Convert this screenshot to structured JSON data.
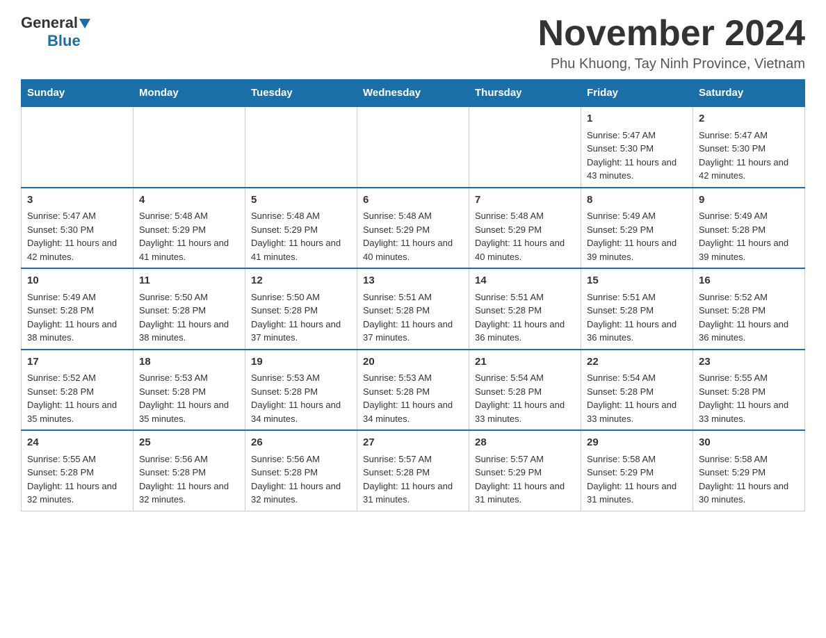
{
  "logo": {
    "general": "General",
    "triangle": "",
    "blue": "Blue"
  },
  "header": {
    "month_year": "November 2024",
    "location": "Phu Khuong, Tay Ninh Province, Vietnam"
  },
  "weekdays": [
    "Sunday",
    "Monday",
    "Tuesday",
    "Wednesday",
    "Thursday",
    "Friday",
    "Saturday"
  ],
  "weeks": [
    [
      {
        "day": "",
        "info": ""
      },
      {
        "day": "",
        "info": ""
      },
      {
        "day": "",
        "info": ""
      },
      {
        "day": "",
        "info": ""
      },
      {
        "day": "",
        "info": ""
      },
      {
        "day": "1",
        "info": "Sunrise: 5:47 AM\nSunset: 5:30 PM\nDaylight: 11 hours and 43 minutes."
      },
      {
        "day": "2",
        "info": "Sunrise: 5:47 AM\nSunset: 5:30 PM\nDaylight: 11 hours and 42 minutes."
      }
    ],
    [
      {
        "day": "3",
        "info": "Sunrise: 5:47 AM\nSunset: 5:30 PM\nDaylight: 11 hours and 42 minutes."
      },
      {
        "day": "4",
        "info": "Sunrise: 5:48 AM\nSunset: 5:29 PM\nDaylight: 11 hours and 41 minutes."
      },
      {
        "day": "5",
        "info": "Sunrise: 5:48 AM\nSunset: 5:29 PM\nDaylight: 11 hours and 41 minutes."
      },
      {
        "day": "6",
        "info": "Sunrise: 5:48 AM\nSunset: 5:29 PM\nDaylight: 11 hours and 40 minutes."
      },
      {
        "day": "7",
        "info": "Sunrise: 5:48 AM\nSunset: 5:29 PM\nDaylight: 11 hours and 40 minutes."
      },
      {
        "day": "8",
        "info": "Sunrise: 5:49 AM\nSunset: 5:29 PM\nDaylight: 11 hours and 39 minutes."
      },
      {
        "day": "9",
        "info": "Sunrise: 5:49 AM\nSunset: 5:28 PM\nDaylight: 11 hours and 39 minutes."
      }
    ],
    [
      {
        "day": "10",
        "info": "Sunrise: 5:49 AM\nSunset: 5:28 PM\nDaylight: 11 hours and 38 minutes."
      },
      {
        "day": "11",
        "info": "Sunrise: 5:50 AM\nSunset: 5:28 PM\nDaylight: 11 hours and 38 minutes."
      },
      {
        "day": "12",
        "info": "Sunrise: 5:50 AM\nSunset: 5:28 PM\nDaylight: 11 hours and 37 minutes."
      },
      {
        "day": "13",
        "info": "Sunrise: 5:51 AM\nSunset: 5:28 PM\nDaylight: 11 hours and 37 minutes."
      },
      {
        "day": "14",
        "info": "Sunrise: 5:51 AM\nSunset: 5:28 PM\nDaylight: 11 hours and 36 minutes."
      },
      {
        "day": "15",
        "info": "Sunrise: 5:51 AM\nSunset: 5:28 PM\nDaylight: 11 hours and 36 minutes."
      },
      {
        "day": "16",
        "info": "Sunrise: 5:52 AM\nSunset: 5:28 PM\nDaylight: 11 hours and 36 minutes."
      }
    ],
    [
      {
        "day": "17",
        "info": "Sunrise: 5:52 AM\nSunset: 5:28 PM\nDaylight: 11 hours and 35 minutes."
      },
      {
        "day": "18",
        "info": "Sunrise: 5:53 AM\nSunset: 5:28 PM\nDaylight: 11 hours and 35 minutes."
      },
      {
        "day": "19",
        "info": "Sunrise: 5:53 AM\nSunset: 5:28 PM\nDaylight: 11 hours and 34 minutes."
      },
      {
        "day": "20",
        "info": "Sunrise: 5:53 AM\nSunset: 5:28 PM\nDaylight: 11 hours and 34 minutes."
      },
      {
        "day": "21",
        "info": "Sunrise: 5:54 AM\nSunset: 5:28 PM\nDaylight: 11 hours and 33 minutes."
      },
      {
        "day": "22",
        "info": "Sunrise: 5:54 AM\nSunset: 5:28 PM\nDaylight: 11 hours and 33 minutes."
      },
      {
        "day": "23",
        "info": "Sunrise: 5:55 AM\nSunset: 5:28 PM\nDaylight: 11 hours and 33 minutes."
      }
    ],
    [
      {
        "day": "24",
        "info": "Sunrise: 5:55 AM\nSunset: 5:28 PM\nDaylight: 11 hours and 32 minutes."
      },
      {
        "day": "25",
        "info": "Sunrise: 5:56 AM\nSunset: 5:28 PM\nDaylight: 11 hours and 32 minutes."
      },
      {
        "day": "26",
        "info": "Sunrise: 5:56 AM\nSunset: 5:28 PM\nDaylight: 11 hours and 32 minutes."
      },
      {
        "day": "27",
        "info": "Sunrise: 5:57 AM\nSunset: 5:28 PM\nDaylight: 11 hours and 31 minutes."
      },
      {
        "day": "28",
        "info": "Sunrise: 5:57 AM\nSunset: 5:29 PM\nDaylight: 11 hours and 31 minutes."
      },
      {
        "day": "29",
        "info": "Sunrise: 5:58 AM\nSunset: 5:29 PM\nDaylight: 11 hours and 31 minutes."
      },
      {
        "day": "30",
        "info": "Sunrise: 5:58 AM\nSunset: 5:29 PM\nDaylight: 11 hours and 30 minutes."
      }
    ]
  ]
}
